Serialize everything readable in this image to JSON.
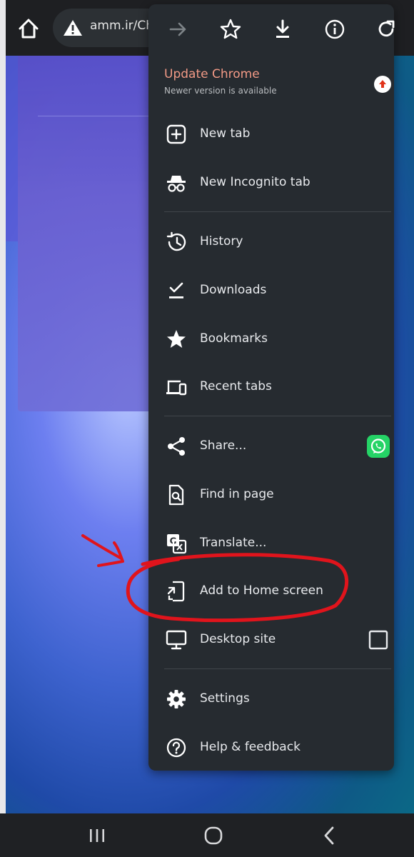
{
  "browser": {
    "url": "amm.ir/Cha"
  },
  "toolbar": {
    "icons": [
      "forward-icon",
      "bookmark-star-icon",
      "download-icon",
      "info-icon",
      "refresh-icon"
    ]
  },
  "update": {
    "title": "Update Chrome",
    "subtitle": "Newer version is available"
  },
  "menu": {
    "items": [
      {
        "label": "New tab",
        "icon": "new-tab-icon"
      },
      {
        "label": "New Incognito tab",
        "icon": "incognito-icon"
      },
      {
        "label": "History",
        "icon": "history-icon"
      },
      {
        "label": "Downloads",
        "icon": "downloads-icon"
      },
      {
        "label": "Bookmarks",
        "icon": "bookmarks-icon"
      },
      {
        "label": "Recent tabs",
        "icon": "recent-tabs-icon"
      },
      {
        "label": "Share...",
        "icon": "share-icon"
      },
      {
        "label": "Find in page",
        "icon": "find-in-page-icon"
      },
      {
        "label": "Translate...",
        "icon": "translate-icon"
      },
      {
        "label": "Add to Home screen",
        "icon": "add-to-home-icon"
      },
      {
        "label": "Desktop site",
        "icon": "desktop-icon"
      },
      {
        "label": "Settings",
        "icon": "settings-gear-icon"
      },
      {
        "label": "Help & feedback",
        "icon": "help-icon"
      }
    ],
    "desktop_site_checked": false
  },
  "colors": {
    "menu_bg": "#262b30",
    "accent_update": "#f29a86",
    "whatsapp": "#25d366",
    "annotation": "#e0141c"
  }
}
